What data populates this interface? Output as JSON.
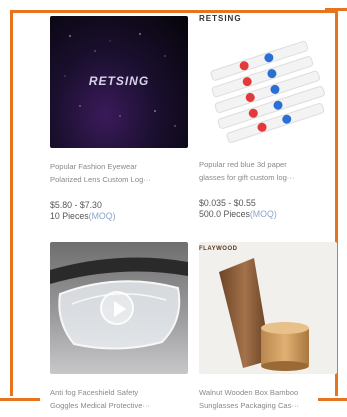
{
  "products": [
    {
      "image_label": "RETSING",
      "title_line1": "Popular Fashion Eyewear",
      "title_line2": "Polarized Lens Custom Log···",
      "price": "$5.80 - $7.30",
      "moq_value": "10 Pieces",
      "moq_unit": "(MOQ)"
    },
    {
      "image_label": "RETSING",
      "title_line1": "Popular red blue 3d paper",
      "title_line2": "glasses for gift custom log···",
      "price": "$0.035 - $0.55",
      "moq_value": "500.0 Pieces",
      "moq_unit": "(MOQ)"
    },
    {
      "title_line1": "Anti fog Faceshield Safety",
      "title_line2": "Goggles Medical Protective···",
      "has_video": true
    },
    {
      "image_label": "FLAYWOOD",
      "title_line1": "Walnut Wooden Box Bamboo",
      "title_line2": "Sunglasses Packaging Cas···"
    }
  ],
  "colors": {
    "frame": "#e8731e",
    "moq_unit": "#8aa6c9",
    "title": "#8a8a8a"
  }
}
